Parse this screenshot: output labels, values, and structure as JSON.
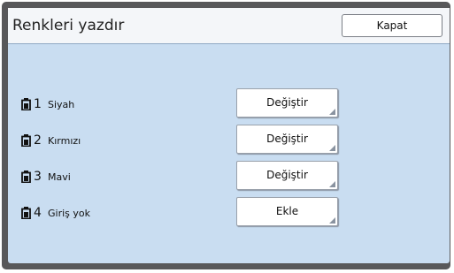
{
  "window": {
    "title": "Renkleri yazdır",
    "close_label": "Kapat"
  },
  "colors": {
    "panel": "#c9ddf1",
    "header": "#f4f6f9",
    "frame": "#58585a"
  },
  "drums": [
    {
      "number": "1",
      "color_name": "Siyah",
      "action_label": "Değiştir",
      "icon": "ink-drum-icon"
    },
    {
      "number": "2",
      "color_name": "Kırmızı",
      "action_label": "Değiştir",
      "icon": "ink-drum-icon"
    },
    {
      "number": "3",
      "color_name": "Mavi",
      "action_label": "Değiştir",
      "icon": "ink-drum-icon"
    },
    {
      "number": "4",
      "color_name": "Giriş yok",
      "action_label": "Ekle",
      "icon": "ink-drum-icon"
    }
  ]
}
